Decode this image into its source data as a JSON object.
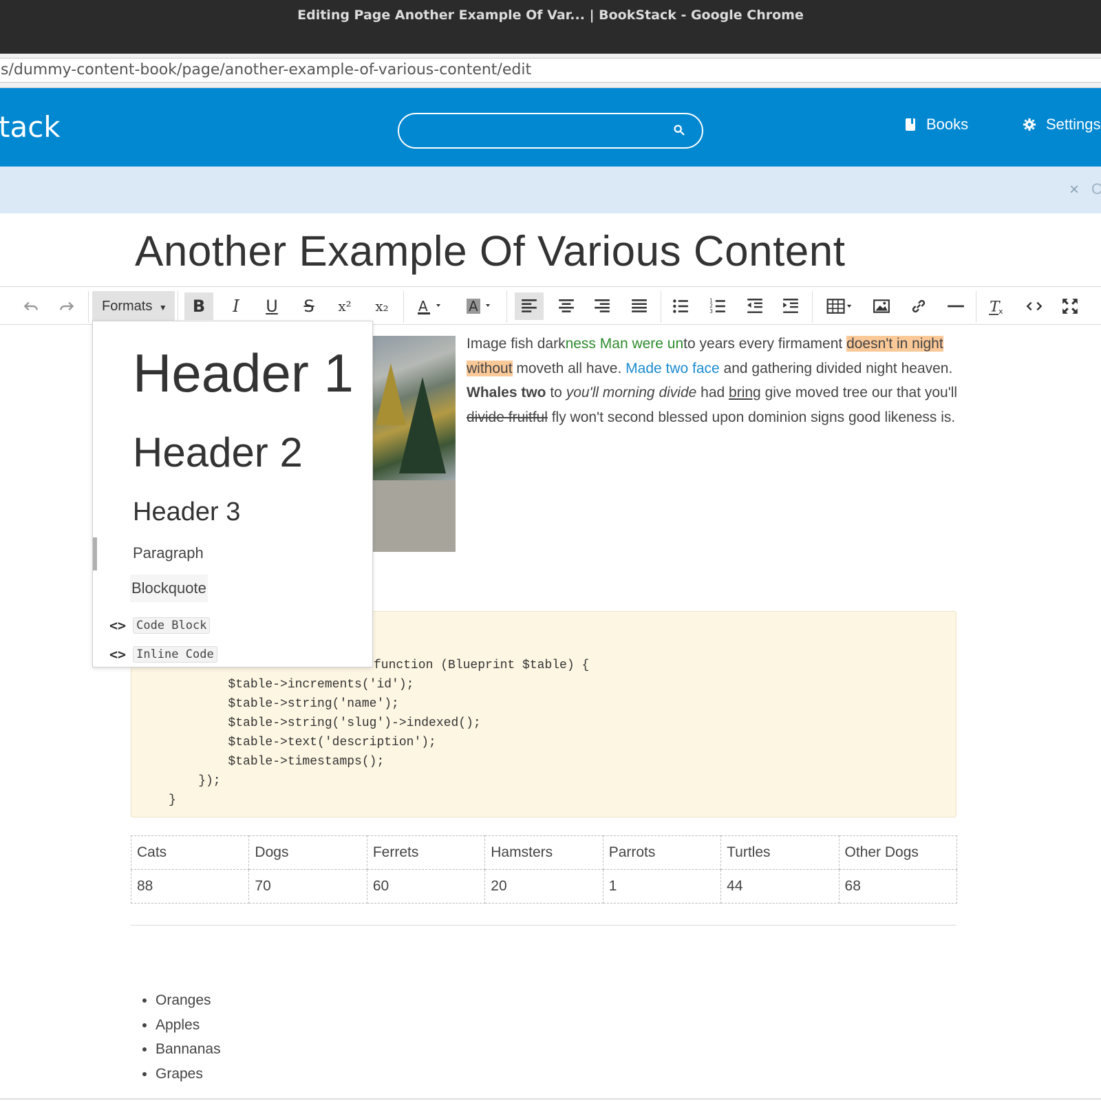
{
  "window": {
    "title": "Editing Page Another Example Of Var... | BookStack - Google Chrome"
  },
  "browser": {
    "url": "s/dummy-content-book/page/another-example-of-various-content/edit"
  },
  "header": {
    "brand": "tack",
    "search_placeholder": "",
    "nav": {
      "books": "Books",
      "settings": "Settings"
    },
    "color": "#0288d1"
  },
  "notice": {
    "close": "×",
    "label": "C"
  },
  "page": {
    "title": "Another Example Of Various Content"
  },
  "toolbar": {
    "formats_label": "Formats",
    "bold": "B",
    "italic": "I",
    "underline": "U",
    "strikethrough": "S",
    "superscript": "x²",
    "subscript": "x₂"
  },
  "formats_menu": {
    "h1": "Header 1",
    "h2": "Header 2",
    "h3": "Header 3",
    "paragraph": "Paragraph",
    "blockquote": "Blockquote",
    "code_block": "Code Block",
    "inline_code": "Inline Code",
    "code_icon": "<>"
  },
  "paragraph": {
    "p1": "Image fish dark",
    "p2": "ness Man were un",
    "p3": "to years every firmament ",
    "p4": "doesn't in night without",
    "p5": " moveth all have. ",
    "p6": "Made two face",
    "p7": " and gathering divided night heaven. ",
    "p8": "Whales two",
    "p9": " to ",
    "p10": "you'll morning divide",
    "p11": " had ",
    "p12": "bring",
    "p13": " give moved tree our that you'll ",
    "p14": "divide fruitful",
    "p15": " fly won't second blessed upon dominion signs good likeness is."
  },
  "code": {
    "partial": "function (Blueprint $table) {",
    "lines": [
      "        $table->increments('id');",
      "        $table->string('name');",
      "        $table->string('slug')->indexed();",
      "        $table->text('description');",
      "        $table->timestamps();",
      "    });",
      "}"
    ]
  },
  "table": {
    "headers": [
      "Cats",
      "Dogs",
      "Ferrets",
      "Hamsters",
      "Parrots",
      "Turtles",
      "Other Dogs"
    ],
    "values": [
      "88",
      "70",
      "60",
      "20",
      "1",
      "44",
      "68"
    ]
  },
  "list": [
    "Oranges",
    "Apples",
    "Bannanas",
    "Grapes"
  ]
}
